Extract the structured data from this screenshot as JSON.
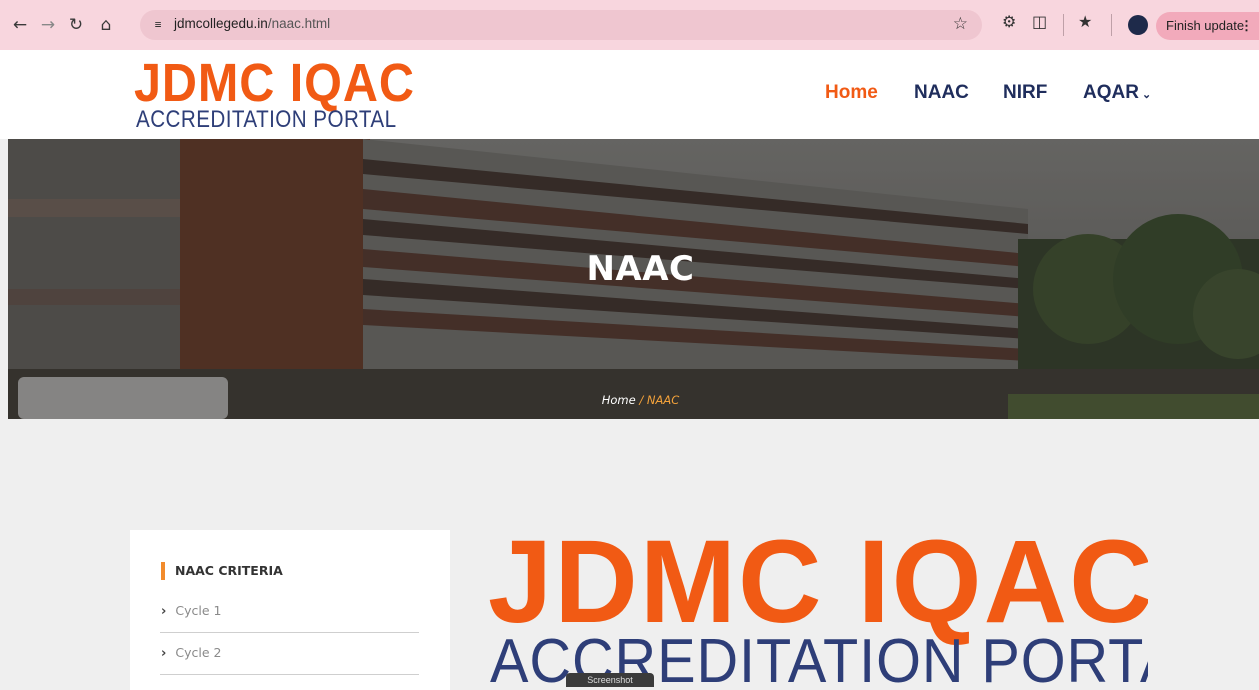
{
  "browser": {
    "url_domain": "jdmcollegedu.in",
    "url_path": "/naac.html",
    "update_button_label": "Finish update"
  },
  "site": {
    "logo_main": "JDMC IQAC",
    "logo_sub": "ACCREDITATION PORTAL",
    "nav": [
      {
        "label": "Home",
        "active": true
      },
      {
        "label": "NAAC"
      },
      {
        "label": "NIRF"
      },
      {
        "label": "AQAR",
        "has_dropdown": true
      }
    ]
  },
  "hero": {
    "title": "NAAC",
    "breadcrumb_home": "Home",
    "breadcrumb_sep": " / ",
    "breadcrumb_current": "NAAC"
  },
  "sidebar": {
    "title": "NAAC CRITERIA",
    "items": [
      {
        "label": "Cycle 1"
      },
      {
        "label": "Cycle 2"
      }
    ]
  },
  "tooltip": {
    "text": "Screenshot"
  },
  "colors": {
    "brand_orange": "#f15a14",
    "brand_navy": "#2e3e78",
    "nav_text": "#1f2d5c",
    "breadcrumb_accent": "#f4a23a",
    "chrome_bg": "#f8d6de"
  }
}
